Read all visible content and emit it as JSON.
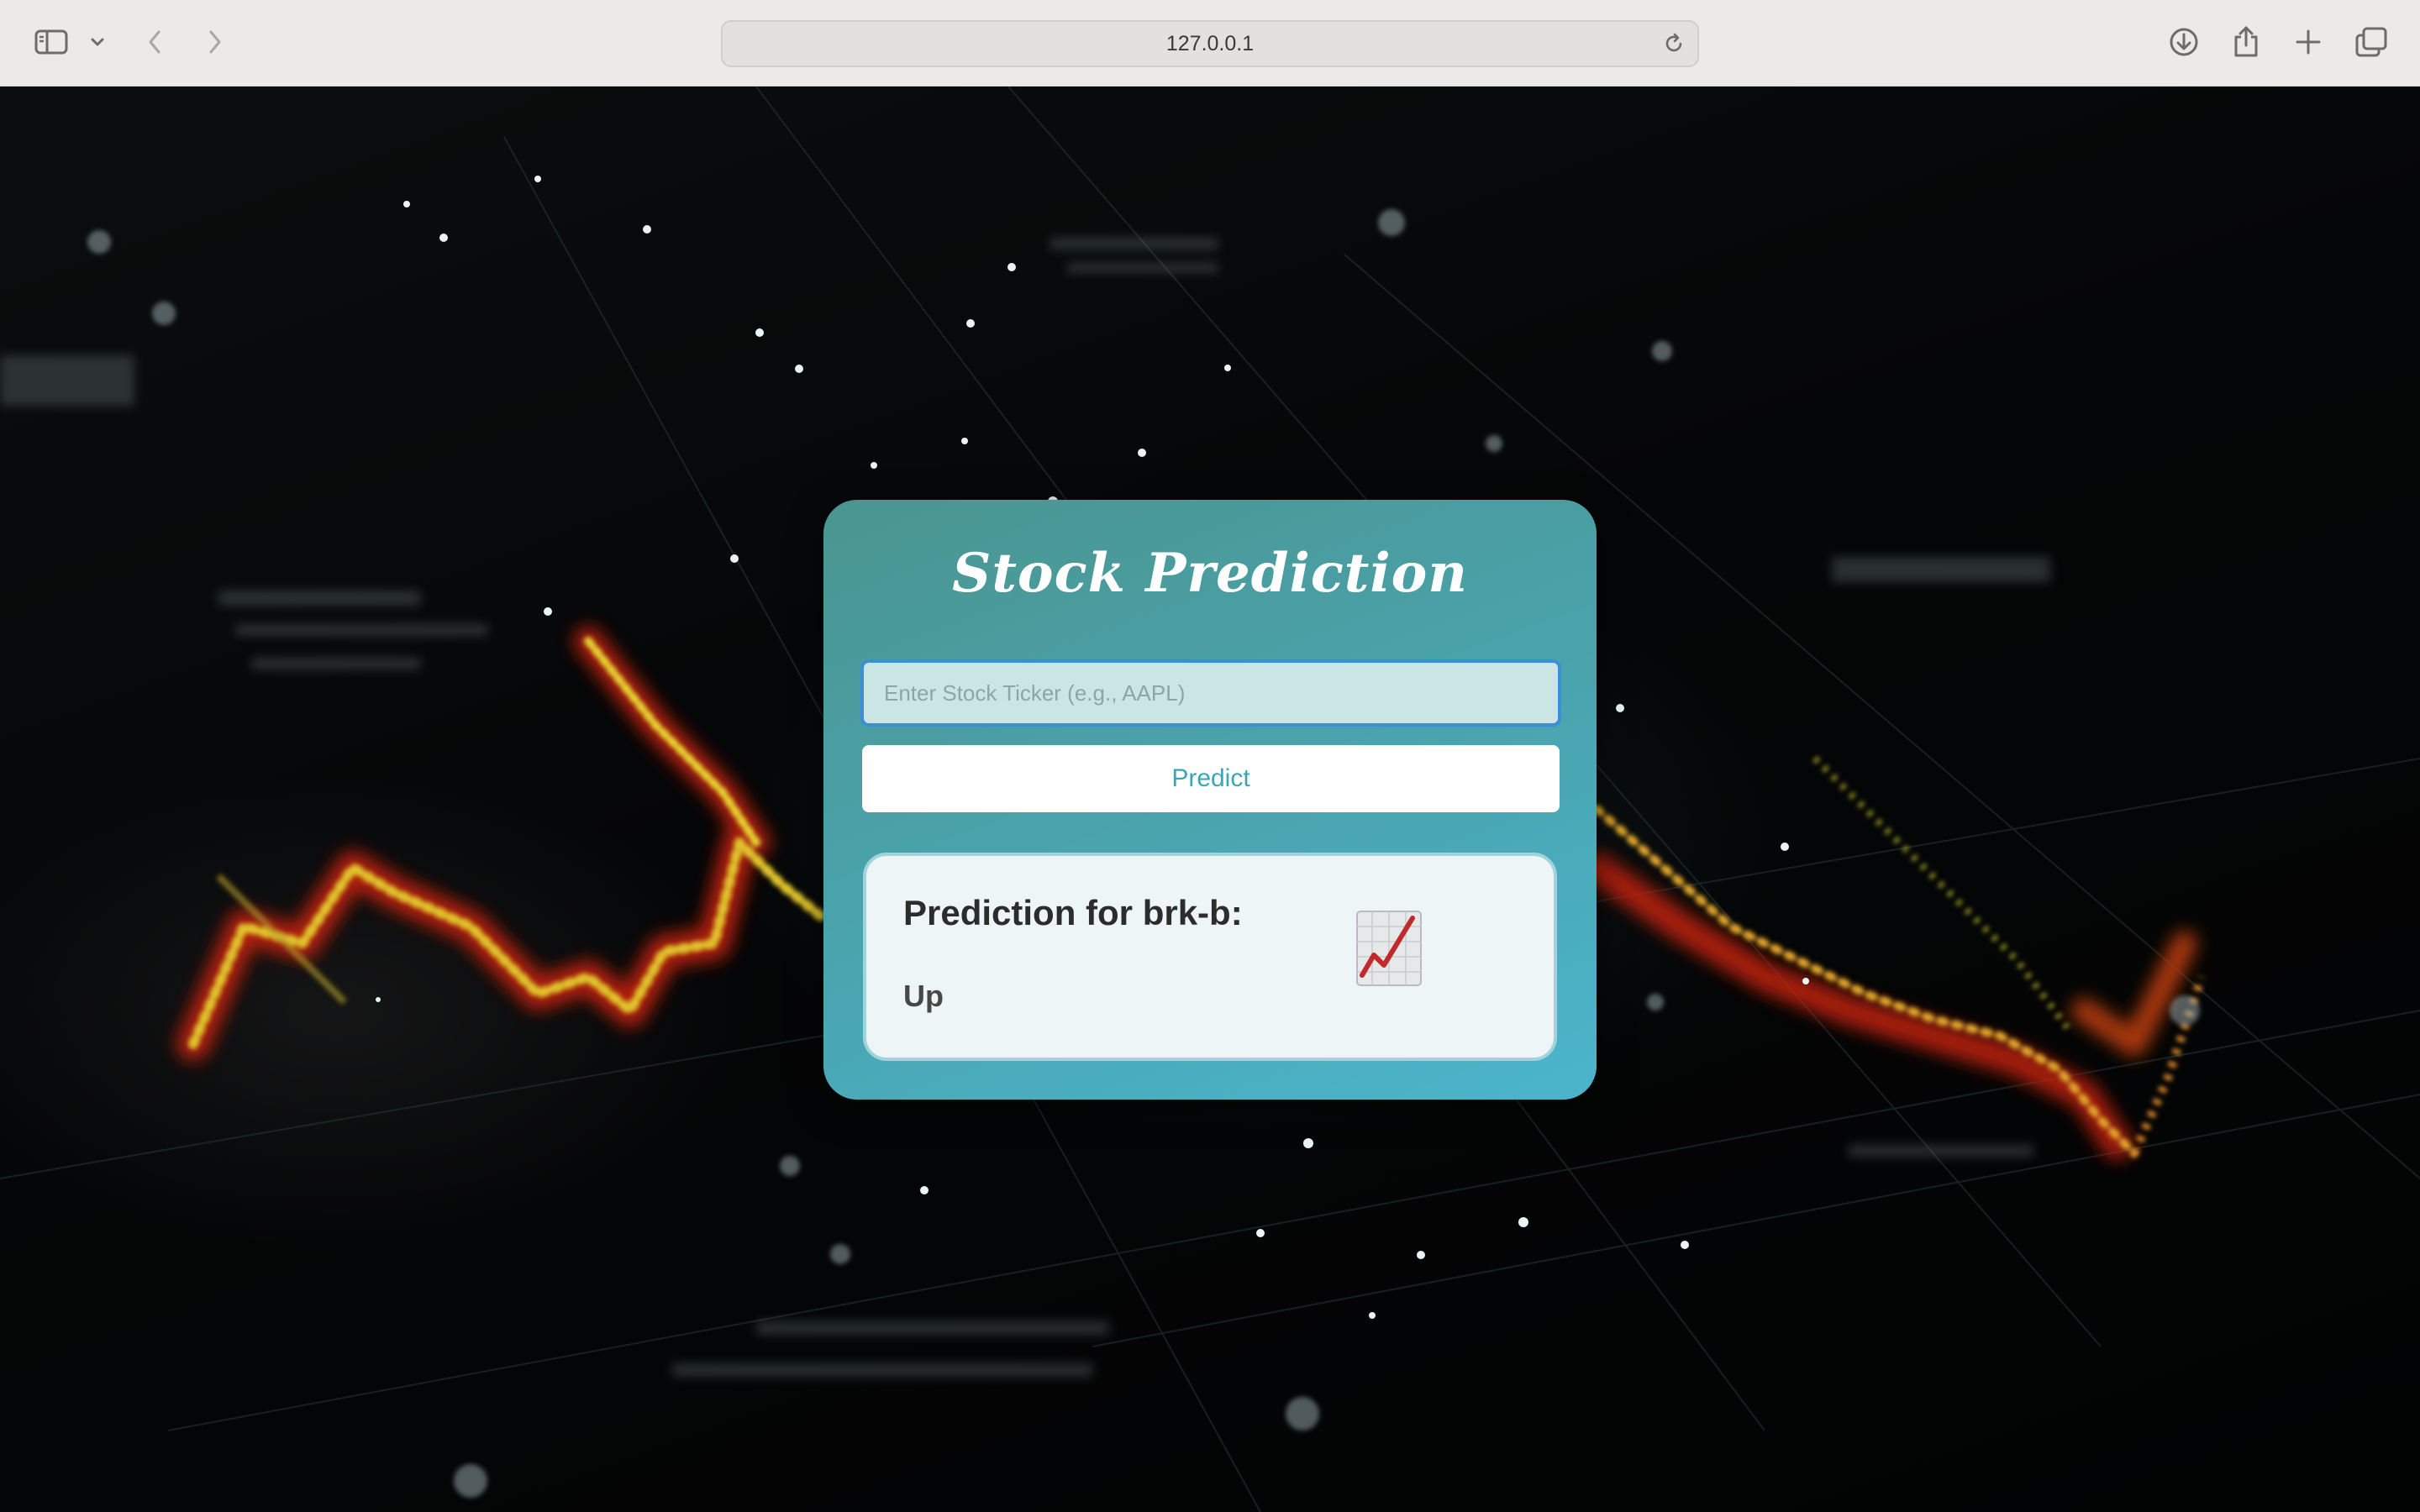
{
  "browser": {
    "url": "127.0.0.1",
    "icons": {
      "sidebar": "sidebar-icon",
      "dropdown": "chevron-down-icon",
      "back": "back-icon",
      "forward": "forward-icon",
      "reload": "reload-icon",
      "download": "download-icon",
      "share": "share-icon",
      "new_tab": "plus-icon",
      "tabs": "tab-overview-icon"
    }
  },
  "card": {
    "title": "Stock Prediction",
    "input": {
      "placeholder": "Enter Stock Ticker (e.g., AAPL)",
      "value": ""
    },
    "predict_label": "Predict",
    "result": {
      "heading": "Prediction for brk-b:",
      "value": "Up",
      "icon": "chart-increasing-icon"
    }
  },
  "colors": {
    "card_gradient_start": "#4a9590",
    "card_gradient_end": "#4bb5cc",
    "button_text": "#3aa7b7",
    "input_border": "#3a8fd6"
  }
}
